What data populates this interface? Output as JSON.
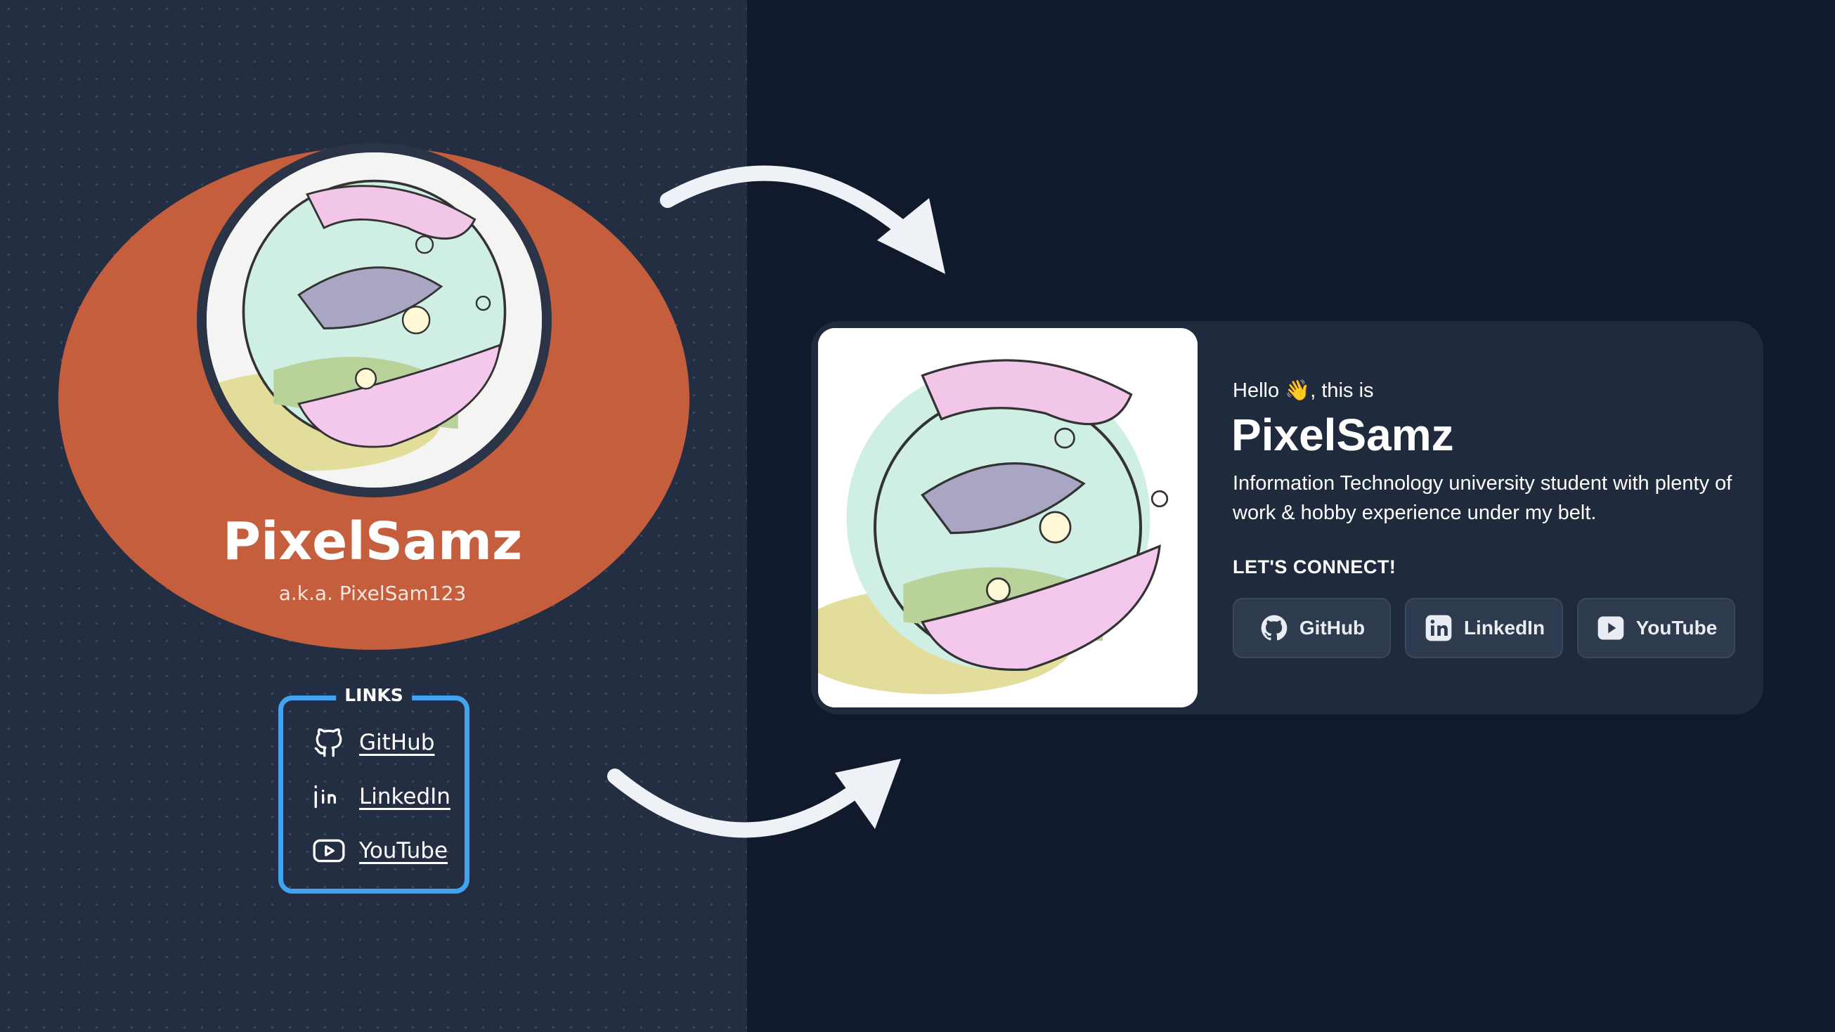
{
  "old_profile": {
    "name": "PixelSamz",
    "aka": "a.k.a. PixelSam123",
    "links_title": "LINKS",
    "links": [
      {
        "label": "GitHub",
        "icon": "github-icon"
      },
      {
        "label": "LinkedIn",
        "icon": "linkedin-icon"
      },
      {
        "label": "YouTube",
        "icon": "youtube-icon"
      }
    ]
  },
  "new_profile": {
    "greeting_prefix": "Hello ",
    "greeting_emoji": "👋",
    "greeting_suffix": ", this is",
    "name": "PixelSamz",
    "bio": "Information Technology university student with plenty of work & hobby experience under my belt.",
    "connect_label": "LET'S CONNECT!",
    "buttons": [
      {
        "label": "GitHub",
        "icon": "github-icon"
      },
      {
        "label": "LinkedIn",
        "icon": "linkedin-icon"
      },
      {
        "label": "YouTube",
        "icon": "youtube-icon"
      }
    ]
  },
  "colors": {
    "background": "#111a2c",
    "left_panel": "#232e42",
    "accent_orange": "#c45e3c",
    "links_border": "#42a4f0",
    "card": "#1f2a3d",
    "button": "#2e3a4e",
    "arrow": "#eef1f5"
  }
}
